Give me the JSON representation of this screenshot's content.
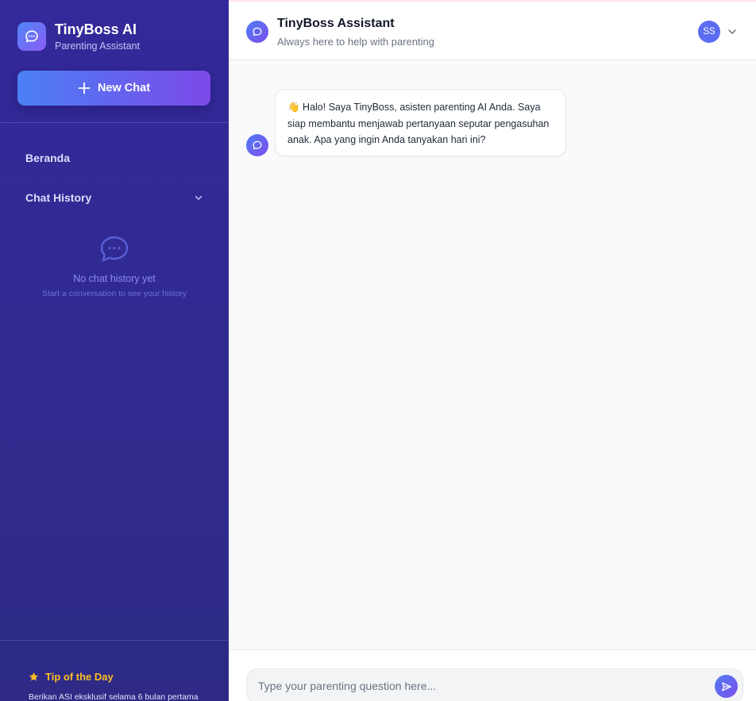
{
  "sidebar": {
    "brand_title": "TinyBoss AI",
    "brand_subtitle": "Parenting Assistant",
    "logo_icon": "chat-bubble-icon",
    "new_chat_label": "New Chat",
    "nav": {
      "home_label": "Beranda",
      "history_label": "Chat History"
    },
    "empty_state": {
      "title": "No chat history yet",
      "subtitle": "Start a conversation to see your history"
    },
    "tip": {
      "title": "Tip of the Day",
      "text": "Berikan ASI eksklusif selama 6 bulan pertama"
    }
  },
  "header": {
    "title": "TinyBoss Assistant",
    "subtitle": "Always here to help with parenting",
    "user_initials": "SS"
  },
  "messages": [
    {
      "sender": "assistant",
      "text": "👋 Halo! Saya TinyBoss, asisten parenting AI Anda. Saya siap membantu menjawab pertanyaan seputar pengasuhan anak. Apa yang ingin Anda tanyakan hari ini?"
    }
  ],
  "composer": {
    "placeholder": "Type your parenting question here...",
    "value": ""
  },
  "colors": {
    "sidebar_bg": "#33299a",
    "accent_start": "#4a80f5",
    "accent_end": "#7c49e8",
    "tip_color": "#fbbf24"
  }
}
